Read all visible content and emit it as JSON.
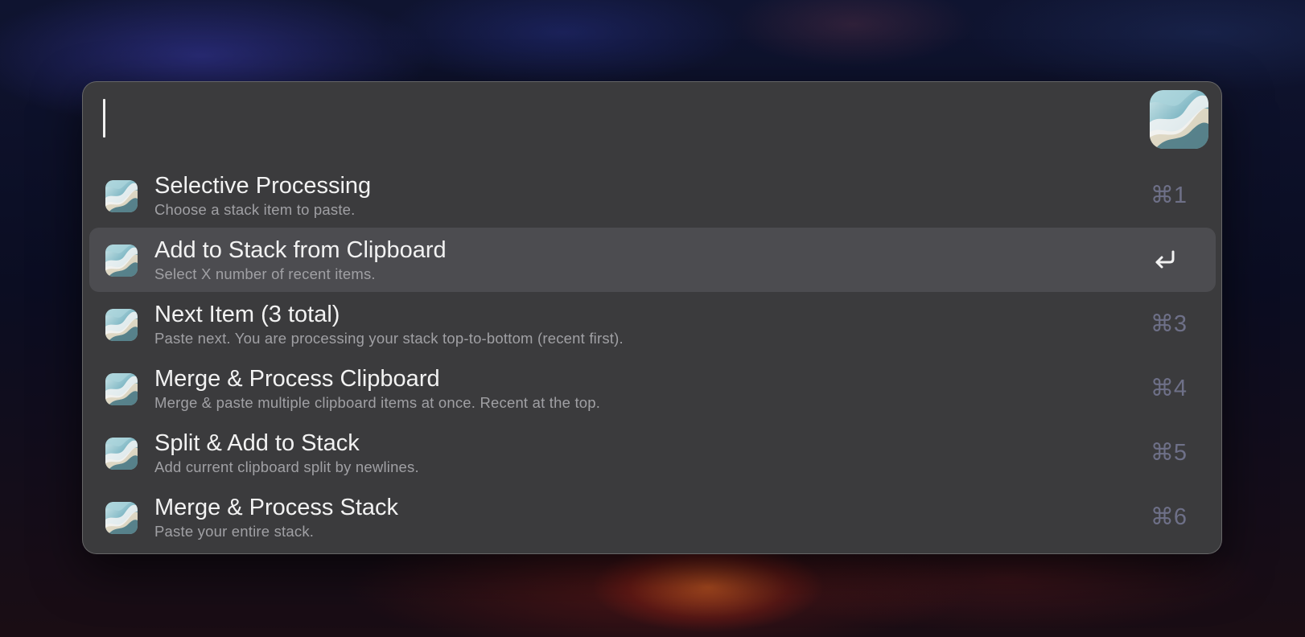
{
  "search": {
    "placeholder": "",
    "value": ""
  },
  "app": {
    "icon": "wave-app-icon"
  },
  "items": [
    {
      "title": "Selective Processing",
      "subtitle": "Choose a stack item to paste.",
      "shortcut": "⌘1",
      "selected": false
    },
    {
      "title": "Add to Stack from Clipboard",
      "subtitle": "Select X number of recent items.",
      "shortcut": "↩",
      "selected": true
    },
    {
      "title": "Next Item (3 total)",
      "subtitle": "Paste next. You are processing your stack top-to-bottom (recent first).",
      "shortcut": "⌘3",
      "selected": false
    },
    {
      "title": "Merge & Process Clipboard",
      "subtitle": "Merge & paste multiple clipboard items at once. Recent at the top.",
      "shortcut": "⌘4",
      "selected": false
    },
    {
      "title": "Split & Add to Stack",
      "subtitle": "Add current clipboard split by newlines.",
      "shortcut": "⌘5",
      "selected": false
    },
    {
      "title": "Merge & Process Stack",
      "subtitle": "Paste your entire stack.",
      "shortcut": "⌘6",
      "selected": false
    }
  ],
  "colors": {
    "panel": "#3b3b3d",
    "selected_row": "#4c4c50",
    "shortcut_text": "#6e7088",
    "subtitle_text": "#a0a0a4"
  }
}
